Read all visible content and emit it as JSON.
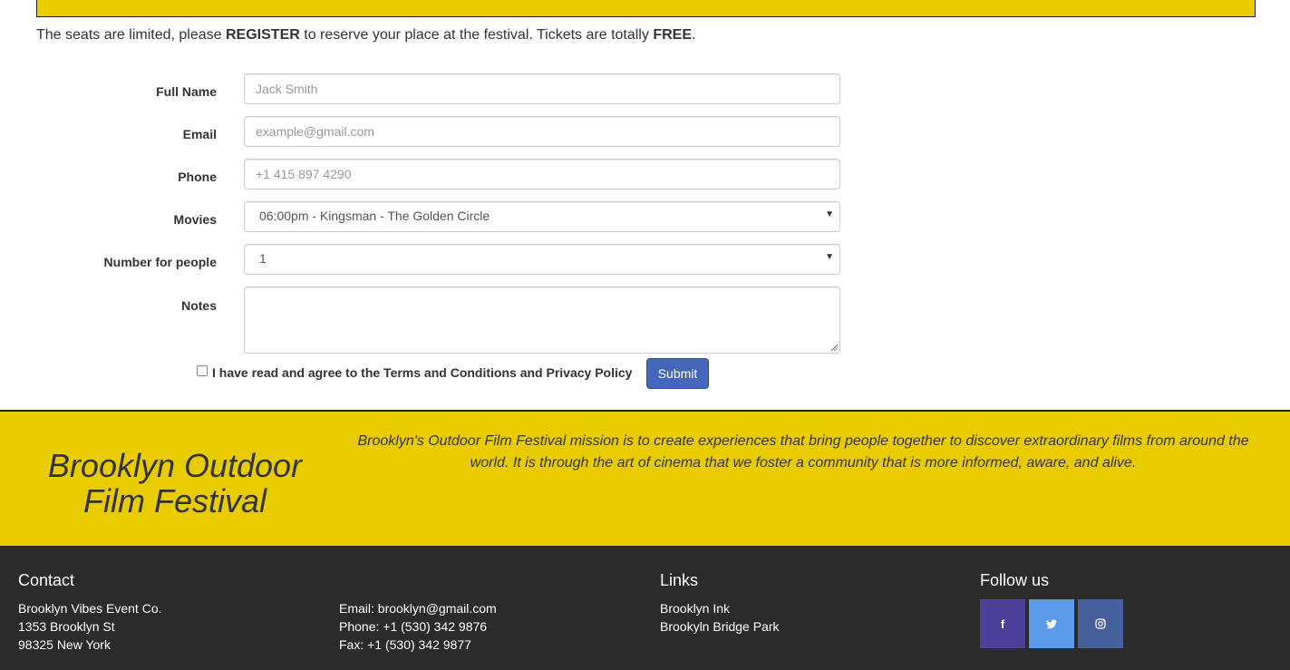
{
  "intro": {
    "part1": "The seats are limited, please ",
    "register": "REGISTER",
    "part2": " to reserve your place at the festival. Tickets are totally ",
    "free": "FREE",
    "part3": "."
  },
  "form": {
    "full_name": {
      "label": "Full Name",
      "placeholder": "Jack Smith"
    },
    "email": {
      "label": "Email",
      "placeholder": "example@gmail.com"
    },
    "phone": {
      "label": "Phone",
      "placeholder": "+1 415 897 4290"
    },
    "movies": {
      "label": "Movies",
      "selected": "06:00pm - Kingsman - The Golden Circle"
    },
    "people": {
      "label": "Number for people",
      "selected": "1"
    },
    "notes": {
      "label": "Notes",
      "value": ""
    },
    "agree_label": "I have read and agree to the Terms and Conditions and Privacy Policy",
    "submit_label": "Submit"
  },
  "band": {
    "title_line1": "Brooklyn Outdoor",
    "title_line2": "Film Festival",
    "mission": "Brooklyn's Outdoor Film Festival mission is to create experiences that bring people together to discover extraordinary films from around the world. It is through the art of cinema that we foster a community that is more informed, aware, and alive."
  },
  "footer": {
    "contact": {
      "heading": "Contact",
      "company": "Brooklyn Vibes Event Co.",
      "street": "1353 Brooklyn St",
      "city": "98325 New York",
      "email": "Email: brooklyn@gmail.com",
      "phone": "Phone: +1 (530) 342 9876",
      "fax": "Fax: +1 (530) 342 9877"
    },
    "links": {
      "heading": "Links",
      "items": [
        "Brooklyn Ink",
        "Brookyln Bridge Park"
      ]
    },
    "follow": {
      "heading": "Follow us",
      "icons": [
        {
          "name": "facebook-icon",
          "glyph": "f",
          "color": "#4b3f9a"
        },
        {
          "name": "twitter-icon",
          "glyph": "🐦",
          "color": "#5b9ae8"
        },
        {
          "name": "instagram-icon",
          "glyph": "◎",
          "color": "#45609c"
        }
      ]
    }
  },
  "colors": {
    "accent_yellow": "#e8cc00",
    "footer_bg": "#2b2b2b",
    "submit_blue": "#4466bb"
  }
}
